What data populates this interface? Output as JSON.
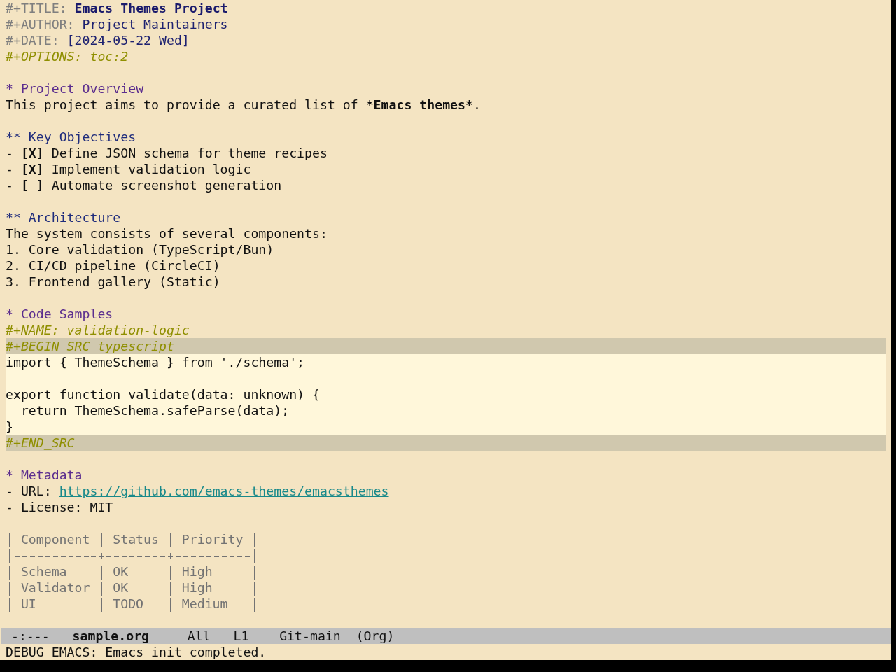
{
  "header": [
    {
      "kind": "title",
      "keyword": "#+TITLE:",
      "value": "Emacs Themes Project"
    },
    {
      "kind": "author",
      "keyword": "#+AUTHOR:",
      "value": "Project Maintainers"
    },
    {
      "kind": "date",
      "keyword": "#+DATE:",
      "value": "[2024-05-22 Wed]"
    },
    {
      "kind": "option",
      "keyword": "#+OPTIONS:",
      "value": "toc:2"
    }
  ],
  "sections": [
    {
      "stars": "*",
      "title": "Project Overview",
      "body": [
        {
          "kind": "paragraph",
          "text": "This project aims to provide a curated list of ",
          "strong": "*Emacs themes*",
          "tail": "."
        }
      ],
      "children": [
        {
          "stars": "**",
          "title": "Key Objectives",
          "body": [
            {
              "kind": "checklist",
              "bullet": "-",
              "box": "[X]",
              "text": "Define JSON schema for theme recipes"
            },
            {
              "kind": "checklist",
              "bullet": "-",
              "box": "[X]",
              "text": "Implement validation logic"
            },
            {
              "kind": "checklist",
              "bullet": "-",
              "box": "[ ]",
              "text": "Automate screenshot generation"
            }
          ]
        },
        {
          "stars": "**",
          "title": "Architecture",
          "body": [
            {
              "kind": "paragraph",
              "text": "The system consists of several components:"
            },
            {
              "kind": "numbered",
              "number": "1.",
              "text": "Core validation (TypeScript/Bun)"
            },
            {
              "kind": "numbered",
              "number": "2.",
              "text": "CI/CD pipeline (CircleCI)"
            },
            {
              "kind": "numbered",
              "number": "3.",
              "text": "Frontend gallery (Static)"
            }
          ]
        }
      ]
    },
    {
      "stars": "*",
      "title": "Code Samples",
      "body": [
        {
          "kind": "keyword_line",
          "text": "#+NAME: validation-logic"
        },
        {
          "kind": "src_block",
          "begin": "#+BEGIN_SRC typescript",
          "code": "import { ThemeSchema } from './schema';\n\nexport function validate(data: unknown) {\n  return ThemeSchema.safeParse(data);\n}",
          "end": "#+END_SRC"
        }
      ]
    },
    {
      "stars": "*",
      "title": "Metadata",
      "body": [
        {
          "kind": "link_item",
          "bullet": "-",
          "label": "URL:",
          "url": "https://github.com/emacs-themes/emacsthemes"
        },
        {
          "kind": "bullet_item",
          "bullet": "-",
          "text": "License: MIT"
        },
        {
          "kind": "table",
          "columns": [
            "Component",
            "Status",
            "Priority"
          ],
          "rows": [
            [
              "Schema",
              "OK",
              "High"
            ],
            [
              "Validator",
              "OK",
              "High"
            ],
            [
              "UI",
              "TODO",
              "Medium"
            ]
          ]
        }
      ]
    }
  ],
  "mode_line": {
    "modified": "-:---",
    "buffer": "sample.org",
    "position": "All",
    "line": "L1",
    "vc": "Git-main",
    "mode": "(Org)"
  },
  "echo_area": "DEBUG EMACS: Emacs init completed."
}
